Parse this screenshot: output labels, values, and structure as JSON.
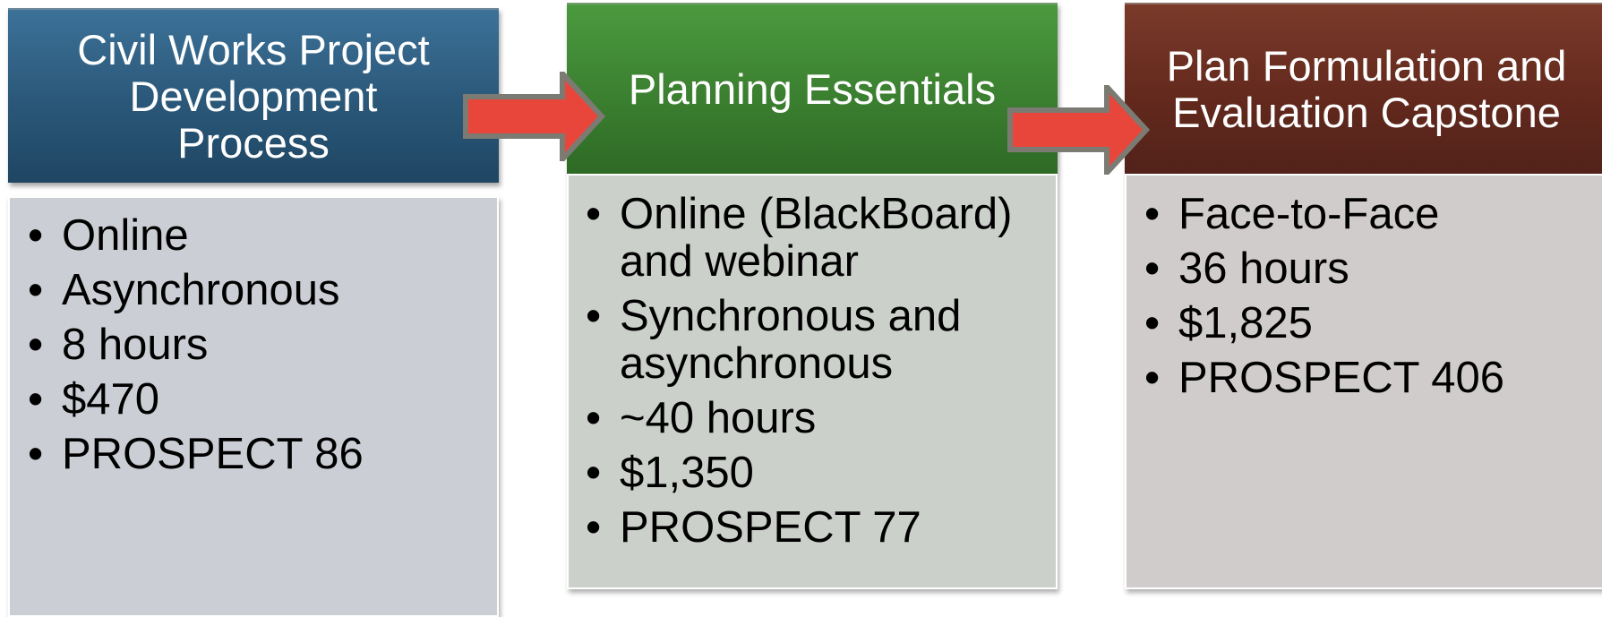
{
  "colors": {
    "step1_header": "#2a5778",
    "step2_header": "#3b7f30",
    "step3_header": "#63291d",
    "step1_body": "#cbced4",
    "step2_body": "#cbd0ca",
    "step3_body": "#d0cccb",
    "arrow_fill": "#e8463a",
    "arrow_outline": "#7b7b74"
  },
  "steps": [
    {
      "title_lines": [
        "Civil Works Project",
        "Development",
        "Process"
      ],
      "bullets": [
        "Online",
        "Asynchronous",
        "8 hours",
        "$470",
        "PROSPECT 86"
      ]
    },
    {
      "title_lines": [
        "Planning Essentials"
      ],
      "bullets": [
        "Online (BlackBoard) and webinar",
        "Synchronous and asynchronous",
        "~40 hours",
        "$1,350",
        "PROSPECT 77"
      ]
    },
    {
      "title_lines": [
        "Plan Formulation and",
        "Evaluation Capstone"
      ],
      "bullets": [
        "Face-to-Face",
        "36 hours",
        "$1,825",
        "PROSPECT 406"
      ]
    }
  ],
  "connectors": [
    {
      "from": 1,
      "to": 2,
      "icon": "right-arrow-icon"
    },
    {
      "from": 2,
      "to": 3,
      "icon": "right-arrow-icon"
    }
  ]
}
